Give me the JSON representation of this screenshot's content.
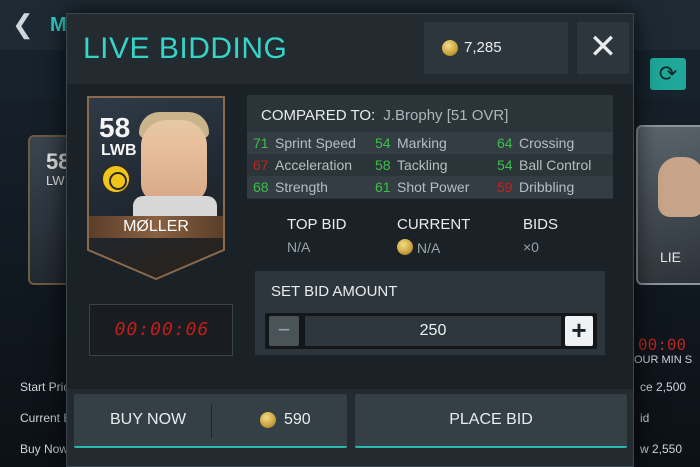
{
  "background": {
    "title_fragment": "M",
    "left_card": {
      "ovr": "58",
      "pos": "LW"
    },
    "right_card": {
      "name": "LIE"
    },
    "left_labels": [
      "Start Pric",
      "Current B",
      "Buy Now"
    ],
    "timer_fragment": "00:00",
    "units_fragment": "OUR  MIN  S",
    "right_values": [
      "ce 2,500",
      "id",
      "w 2,550"
    ]
  },
  "modal": {
    "title": "LIVE BIDDING",
    "coins": "7,285",
    "close_symbol": "✕"
  },
  "player": {
    "ovr": "58",
    "position": "LWB",
    "name": "MØLLER"
  },
  "timer": "00:00:06",
  "comparison": {
    "label": "COMPARED TO:",
    "player": "J.Brophy [51 OVR]",
    "stats": [
      [
        {
          "value": "71",
          "name": "Sprint Speed",
          "color": "green"
        },
        {
          "value": "54",
          "name": "Marking",
          "color": "green"
        },
        {
          "value": "64",
          "name": "Crossing",
          "color": "green"
        }
      ],
      [
        {
          "value": "67",
          "name": "Acceleration",
          "color": "red"
        },
        {
          "value": "58",
          "name": "Tackling",
          "color": "green"
        },
        {
          "value": "54",
          "name": "Ball Control",
          "color": "green"
        }
      ],
      [
        {
          "value": "68",
          "name": "Strength",
          "color": "green"
        },
        {
          "value": "61",
          "name": "Shot Power",
          "color": "green"
        },
        {
          "value": "59",
          "name": "Dribbling",
          "color": "red"
        }
      ]
    ]
  },
  "bid_info": {
    "top_bid_label": "TOP BID",
    "top_bid_value": "N/A",
    "current_label": "CURRENT",
    "current_value": "N/A",
    "bids_label": "BIDS",
    "bids_value": "×0"
  },
  "bid_amount": {
    "title": "SET BID AMOUNT",
    "minus": "−",
    "value": "250",
    "plus": "+"
  },
  "buttons": {
    "buy_now_label": "BUY NOW",
    "buy_now_price": "590",
    "place_bid_label": "PLACE BID"
  },
  "colors": {
    "accent": "#35d4c9",
    "stat_good": "#3cc04b",
    "stat_bad": "#c0241e",
    "timer": "#c01e18"
  }
}
